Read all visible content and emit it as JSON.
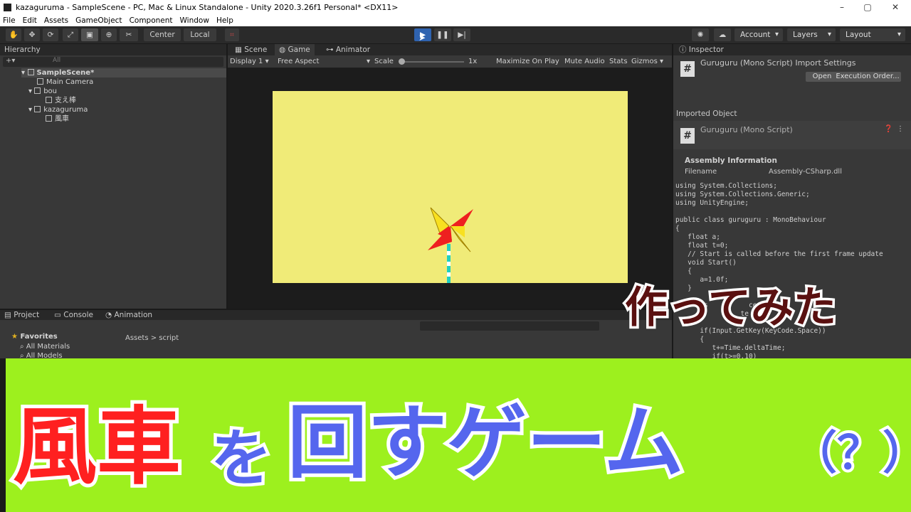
{
  "window": {
    "title": "kazaguruma - SampleScene - PC, Mac & Linux Standalone - Unity 2020.3.26f1 Personal* <DX11>"
  },
  "menu": [
    "File",
    "Edit",
    "Assets",
    "GameObject",
    "Component",
    "Window",
    "Help"
  ],
  "toolbar": {
    "center": "Center",
    "local": "Local",
    "account": "Account",
    "layers": "Layers",
    "layout": "Layout"
  },
  "hierarchy": {
    "title": "Hierarchy",
    "search_placeholder": "All",
    "items": [
      "SampleScene*",
      "Main Camera",
      "bou",
      "支え棒",
      "kazaguruma",
      "風車"
    ]
  },
  "scene_tabs": {
    "scene": "Scene",
    "game": "Game",
    "animator": "Animator"
  },
  "game_bar": {
    "display": "Display 1",
    "aspect": "Free Aspect",
    "scale_label": "Scale",
    "scale_value": "1x",
    "maximize": "Maximize On Play",
    "mute": "Mute Audio",
    "stats": "Stats",
    "gizmos": "Gizmos"
  },
  "inspector": {
    "title": "Inspector",
    "import_title": "Guruguru (Mono Script) Import Settings",
    "open": "Open",
    "execution_order": "Execution Order...",
    "imported_object": "Imported Object",
    "object_name": "Guruguru (Mono Script)",
    "assembly_info": "Assembly Information",
    "filename_label": "Filename",
    "filename_value": "Assembly-CSharp.dll"
  },
  "code_lines": [
    "using System.Collections;",
    "using System.Collections.Generic;",
    "using UnityEngine;",
    "",
    "public class guruguru : MonoBehaviour",
    "{",
    "   float a;",
    "   float t=0;",
    "   // Start is called before the first frame update",
    "   void Start()",
    "   {",
    "      a=1.0f;",
    "   }",
    "",
    "      is          ce",
    "                te",
    "   {",
    "      if(Input.GetKey(KeyCode.Space))",
    "      {",
    "         t+=Time.deltaTime;",
    "         if(t>=0.10)"
  ],
  "bottom": {
    "project": "Project",
    "console": "Console",
    "animation": "Animation",
    "favorites": "Favorites",
    "all_materials": "All Materials",
    "all_models": "All Models",
    "breadcrumb_root": "Assets",
    "breadcrumb_leaf": "script"
  },
  "overlay": {
    "tsukutte": "作ってみた",
    "part1": "風車",
    "part2": "を",
    "part3": "回すゲーム",
    "part4": "（？）"
  },
  "colors": {
    "game_bg": "#f0eb78",
    "banner": "#9df01e",
    "red": "#ff2020",
    "blue": "#5566ee"
  }
}
